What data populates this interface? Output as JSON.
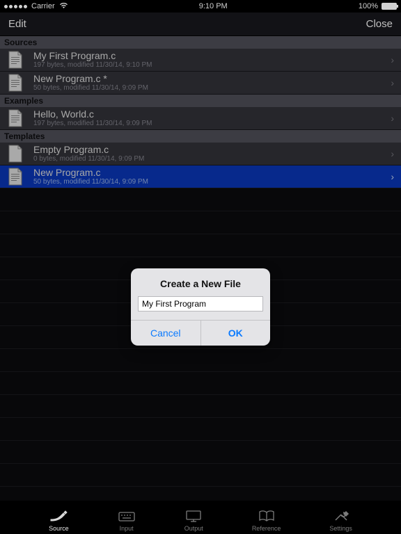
{
  "statusBar": {
    "carrier": "Carrier",
    "wifi": true,
    "time": "9:10 PM",
    "battery": "100%"
  },
  "nav": {
    "left": "Edit",
    "right": "Close"
  },
  "sections": {
    "sources": {
      "header": "Sources",
      "items": [
        {
          "title": "My First Program.c",
          "sub": "197 bytes, modified 11/30/14, 9:10 PM"
        },
        {
          "title": "New Program.c *",
          "sub": "50 bytes, modified 11/30/14, 9:09 PM"
        }
      ]
    },
    "examples": {
      "header": "Examples",
      "items": [
        {
          "title": "Hello, World.c",
          "sub": "197 bytes, modified 11/30/14, 9:09 PM"
        }
      ]
    },
    "templates": {
      "header": "Templates",
      "items": [
        {
          "title": "Empty Program.c",
          "sub": "0 bytes, modified 11/30/14, 9:09 PM"
        },
        {
          "title": "New Program.c",
          "sub": "50 bytes, modified 11/30/14, 9:09 PM",
          "selected": true
        }
      ]
    }
  },
  "dialog": {
    "title": "Create a New File",
    "inputValue": "My First Program",
    "cancel": "Cancel",
    "ok": "OK"
  },
  "tabs": [
    {
      "label": "Source",
      "icon": "pen-icon",
      "active": true
    },
    {
      "label": "Input",
      "icon": "keyboard-icon",
      "active": false
    },
    {
      "label": "Output",
      "icon": "monitor-icon",
      "active": false
    },
    {
      "label": "Reference",
      "icon": "book-icon",
      "active": false
    },
    {
      "label": "Settings",
      "icon": "tools-icon",
      "active": false
    }
  ],
  "icons": {
    "doc-icon": "doc-icon",
    "chevron-right-icon": "›",
    "wifi-icon": "wifi-icon"
  }
}
